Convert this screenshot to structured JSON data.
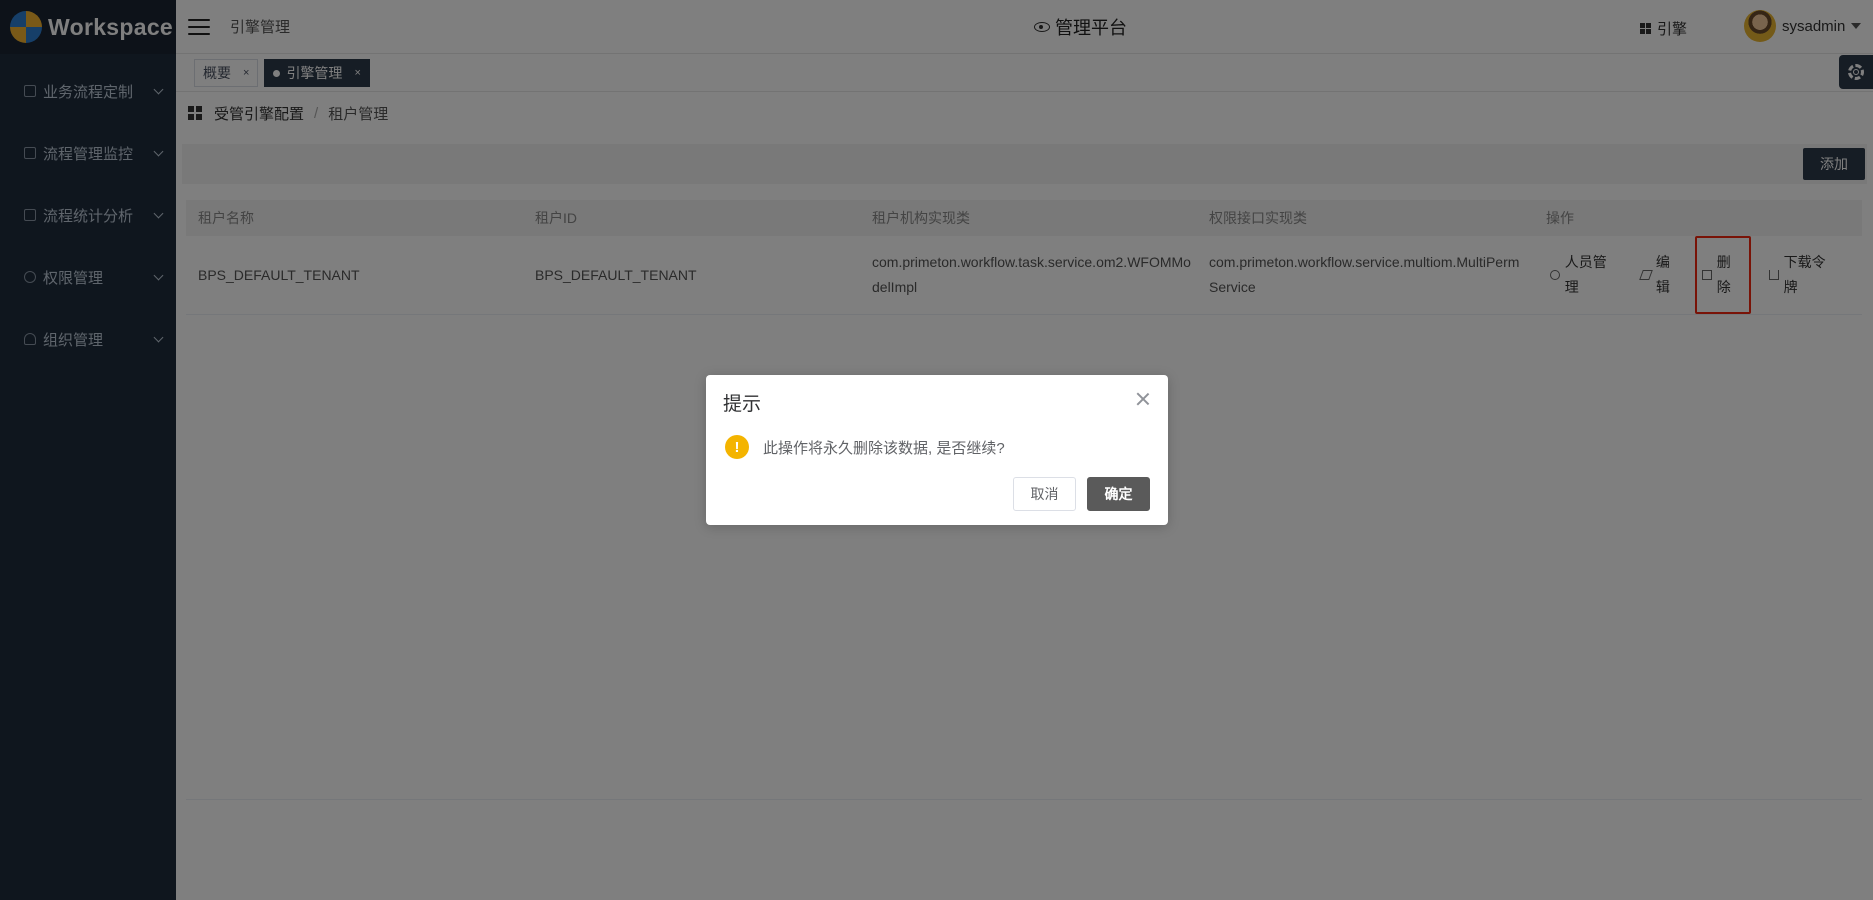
{
  "app": {
    "logo_text": "Workspace"
  },
  "sidebar": {
    "items": [
      {
        "label": "业务流程定制",
        "icon": "flow-icon"
      },
      {
        "label": "流程管理监控",
        "icon": "monitor-icon"
      },
      {
        "label": "流程统计分析",
        "icon": "chart-icon"
      },
      {
        "label": "权限管理",
        "icon": "permission-icon"
      },
      {
        "label": "组织管理",
        "icon": "user-icon"
      }
    ]
  },
  "header": {
    "breadcrumb": "引擎管理",
    "title": "管理平台",
    "engine_label": "引擎",
    "username": "sysadmin"
  },
  "tabs": [
    {
      "label": "概要",
      "active": false
    },
    {
      "label": "引擎管理",
      "active": true
    }
  ],
  "breadcrumb": {
    "parent": "受管引擎配置",
    "sep": "/",
    "current": "租户管理"
  },
  "toolbar": {
    "add_label": "添加"
  },
  "table": {
    "columns": [
      "租户名称",
      "租户ID",
      "租户机构实现类",
      "权限接口实现类",
      "操作"
    ],
    "rows": [
      {
        "name": "BPS_DEFAULT_TENANT",
        "id": "BPS_DEFAULT_TENANT",
        "org_impl": "com.primeton.workflow.task.service.om2.WFOMModelImpl",
        "perm_impl": "com.primeton.workflow.service.multiom.MultiPermService"
      }
    ],
    "actions": {
      "people": "人员管理",
      "edit": "编辑",
      "delete": "删除",
      "download": "下载令牌"
    }
  },
  "dialog": {
    "title": "提示",
    "message": "此操作将永久删除该数据, 是否继续?",
    "warn_symbol": "!",
    "cancel_label": "取消",
    "confirm_label": "确定"
  },
  "colors": {
    "sidebar_bg": "#1f2d3d",
    "accent_dark": "#2d3a4b",
    "highlight_red": "#f2260f",
    "warning": "#f4b400"
  }
}
